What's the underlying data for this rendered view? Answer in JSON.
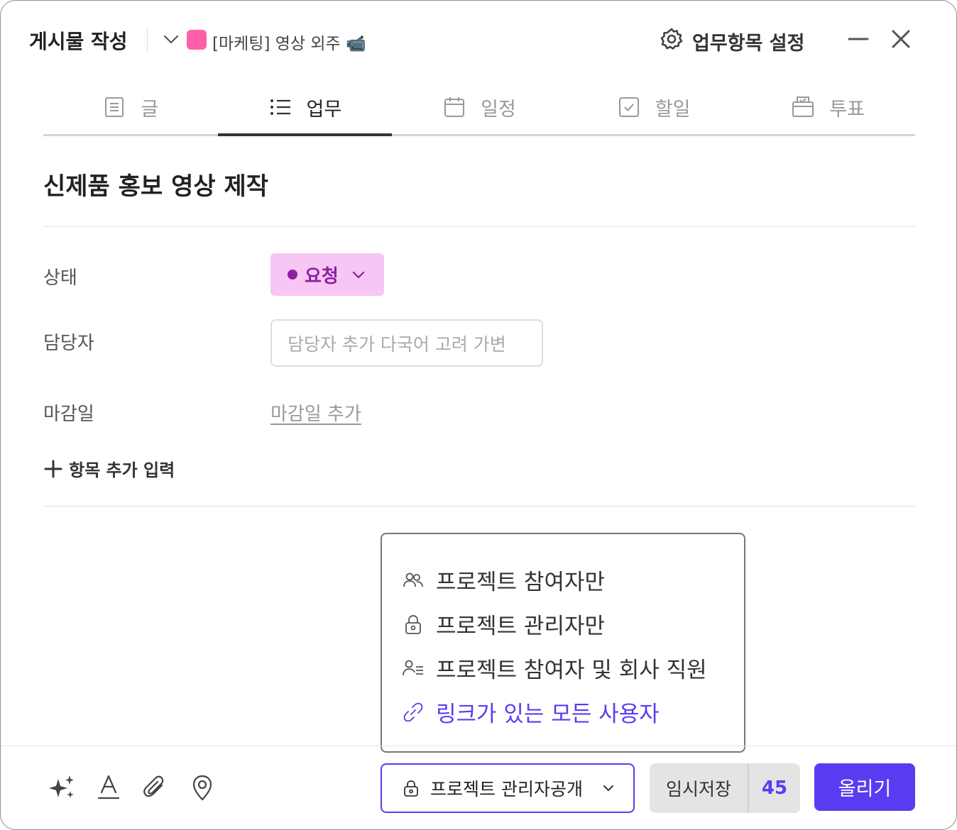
{
  "header": {
    "title": "게시물 작성",
    "project": {
      "name": "[마케팅] 영상 외주 📹",
      "color": "#ff5fa8"
    },
    "settings_label": "업무항목 설정",
    "settings_icon": "gear-icon",
    "minimize_icon": "minimize-icon",
    "close_icon": "close-icon"
  },
  "tabs": [
    {
      "label": "글",
      "icon": "document-icon",
      "active": false
    },
    {
      "label": "업무",
      "icon": "list-icon",
      "active": true
    },
    {
      "label": "일정",
      "icon": "calendar-icon",
      "active": false
    },
    {
      "label": "할일",
      "icon": "checkbox-icon",
      "active": false
    },
    {
      "label": "투표",
      "icon": "vote-icon",
      "active": false
    }
  ],
  "post": {
    "title": "신제품 홍보 영상 제작"
  },
  "fields": {
    "status": {
      "label": "상태",
      "value": "요청",
      "color": "#8b1fa2",
      "bg": "#f7c6f4"
    },
    "assignee": {
      "label": "담당자",
      "placeholder": "담당자 추가 다국어 고려 가변"
    },
    "deadline": {
      "label": "마감일",
      "link": "마감일 추가"
    },
    "add_item": "항목 추가 입력"
  },
  "visibility_menu": {
    "items": [
      {
        "label": "프로젝트 참여자만",
        "icon": "people-icon"
      },
      {
        "label": "프로젝트 관리자만",
        "icon": "lock-icon"
      },
      {
        "label": "프로젝트 참여자 및 회사 직원",
        "icon": "people-list-icon"
      },
      {
        "label": "링크가 있는 모든 사용자",
        "icon": "link-icon"
      }
    ]
  },
  "footer": {
    "tools": [
      "sparkle-icon",
      "text-format-icon",
      "paperclip-icon",
      "location-pin-icon"
    ],
    "visibility_value": "프로젝트 관리자공개",
    "draft_label": "임시저장",
    "draft_count": "45",
    "submit_label": "올리기",
    "accent": "#5a3cf0"
  }
}
